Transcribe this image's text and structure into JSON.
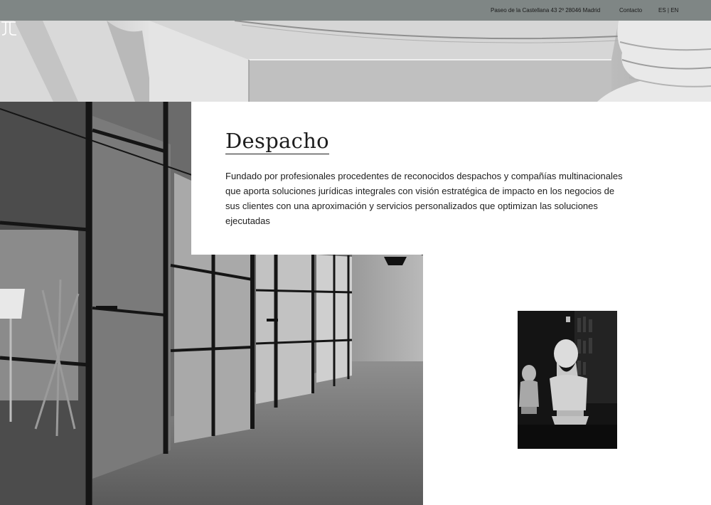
{
  "topbar": {
    "address": "Paseo de la Castellana 43 2º 28046 Madrid",
    "contact": "Contacto",
    "language": "ES | EN"
  },
  "hero": {
    "image": "marble-column-base"
  },
  "logo": {
    "icon": "jl-monogram-icon"
  },
  "section": {
    "title": "Despacho",
    "description": "Fundado por profesionales procedentes de reconocidos despachos y compañías multinacionales que aporta soluciones jurídicas integrales con visión estratégica de impacto en los negocios de sus clientes con una aproximación y servicios personalizados que optimizan las soluciones ejecutadas"
  },
  "images": {
    "office": "office-glass-partitions",
    "bust": "marble-busts-library"
  },
  "colors": {
    "topbar_bg": "#7f8685",
    "text": "#1d1d1d",
    "background": "#ffffff"
  }
}
